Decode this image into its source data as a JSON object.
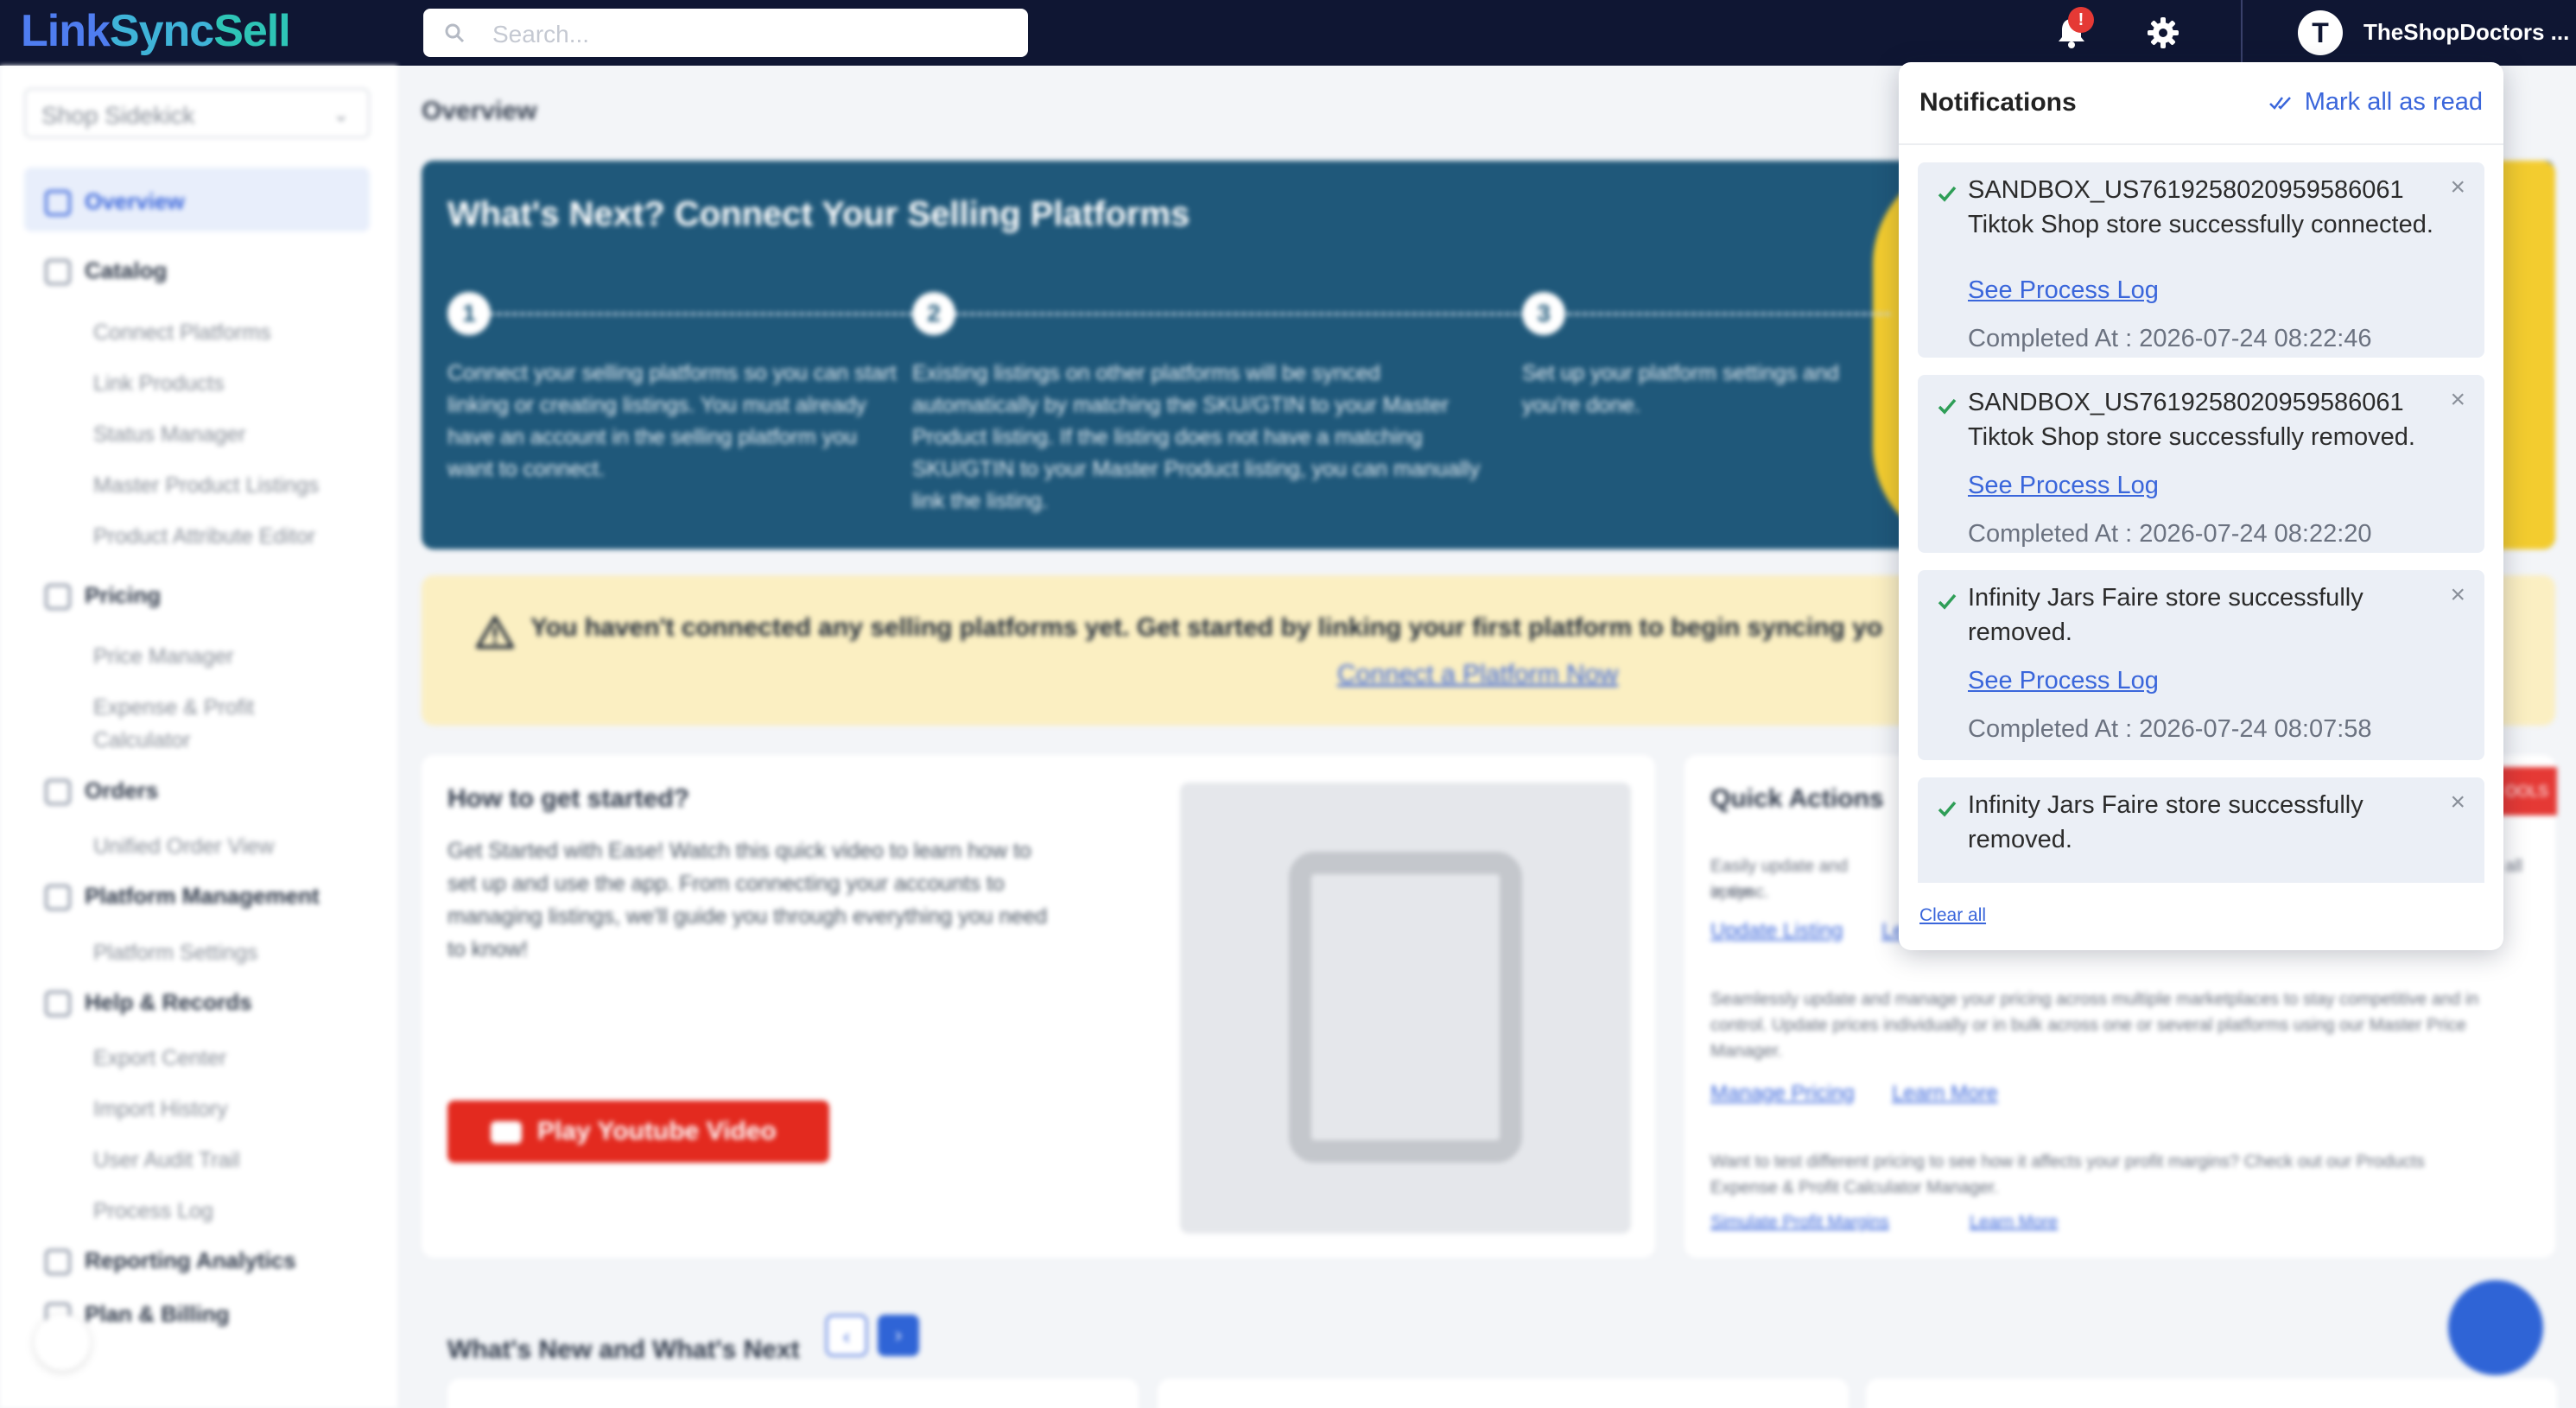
{
  "app": {
    "logo_part1": "Link",
    "logo_part2": "Sync",
    "logo_part3": "Sell",
    "search_placeholder": "Search...",
    "notification_badge": "!",
    "avatar_initial": "T",
    "username": "TheShopDoctors ...",
    "accent_color": "#3a66db"
  },
  "sidebar": {
    "shop_select": "Shop Sidekick",
    "items": [
      {
        "label": "Overview",
        "icon": "document-search-icon"
      },
      {
        "label": "Catalog",
        "icon": "catalog-icon"
      },
      {
        "label": "Connect Platforms"
      },
      {
        "label": "Link Products"
      },
      {
        "label": "Status Manager"
      },
      {
        "label": "Master Product Listings"
      },
      {
        "label": "Product Attribute Editor"
      },
      {
        "label": "Pricing",
        "icon": "pricing-icon"
      },
      {
        "label": "Price Manager"
      },
      {
        "label": "Expense & Profit"
      },
      {
        "label": "Calculator"
      },
      {
        "label": "Orders",
        "icon": "orders-icon"
      },
      {
        "label": "Unified Order View"
      },
      {
        "label": "Platform Management",
        "icon": "platform-icon"
      },
      {
        "label": "Platform Settings"
      },
      {
        "label": "Help & Records",
        "icon": "records-icon"
      },
      {
        "label": "Export Center"
      },
      {
        "label": "Import History"
      },
      {
        "label": "User Audit Trail"
      },
      {
        "label": "Process Log"
      },
      {
        "label": "Reporting Analytics",
        "icon": "analytics-icon"
      },
      {
        "label": "Plan & Billing",
        "icon": "billing-icon"
      }
    ]
  },
  "main": {
    "title": "Overview",
    "banner": {
      "heading": "What's Next? Connect Your Selling Platforms",
      "steps": [
        {
          "num": "1",
          "text": "Connect your selling platforms so you can start linking or creating listings. You must already have an account in the selling platform you want to connect."
        },
        {
          "num": "2",
          "text": "Existing listings on other platforms will be synced automatically by matching the SKU/GTIN to your Master Product listing. If the listing does not have a matching SKU/GTIN to your Master Product listing, you can manually link the listing."
        },
        {
          "num": "3",
          "text": "Set up your platform settings and you're done."
        }
      ]
    },
    "alert": {
      "message": "You haven't connected any selling platforms yet. Get started by linking your first platform to begin syncing yo",
      "link": "Connect a Platform Now"
    },
    "get_started": {
      "title": "How to get started?",
      "body": "Get Started with Ease! Watch this quick video to learn how to set up and use the app. From connecting your accounts to managing listings, we'll guide you through everything you need to know!",
      "button": "Play Youtube Video"
    },
    "quick_actions": {
      "title": "Quick Actions",
      "ribbon": "OOLS",
      "text1": "Easily update and optim",
      "text1b": "all",
      "text1c": "in sync.",
      "link1": "Update Listing",
      "link1b": "Le",
      "text2": "Seamlessly update and manage your pricing across multiple marketplaces to stay competitive and in control. Update prices individually or in bulk across one or several platforms using our Master Price Manager.",
      "link2": "Manage Pricing",
      "link3": "Learn More",
      "text3": "Want to test different pricing to see how it affects your profit margins? Check out our Products Expense & Profit Calculator Manager.",
      "link4": "Simulate Profit Margins",
      "link5": "Learn More"
    },
    "news": {
      "title": "What's New and What's Next",
      "prev": "‹",
      "next": "›"
    }
  },
  "notifications": {
    "title": "Notifications",
    "mark_all": "Mark all as read",
    "clear_all": "Clear all",
    "items": [
      {
        "message": "SANDBOX_US7619258020959586061 Tiktok Shop store successfully connected.",
        "link": "See Process Log",
        "completed": "Completed At : 2026-07-24 08:22:46"
      },
      {
        "message": "SANDBOX_US7619258020959586061 Tiktok Shop store successfully removed.",
        "link": "See Process Log",
        "completed": "Completed At : 2026-07-24 08:22:20"
      },
      {
        "message": "Infinity Jars Faire store successfully removed.",
        "link": "See Process Log",
        "completed": "Completed At : 2026-07-24 08:07:58"
      },
      {
        "message": "Infinity Jars Faire store successfully removed."
      }
    ]
  }
}
